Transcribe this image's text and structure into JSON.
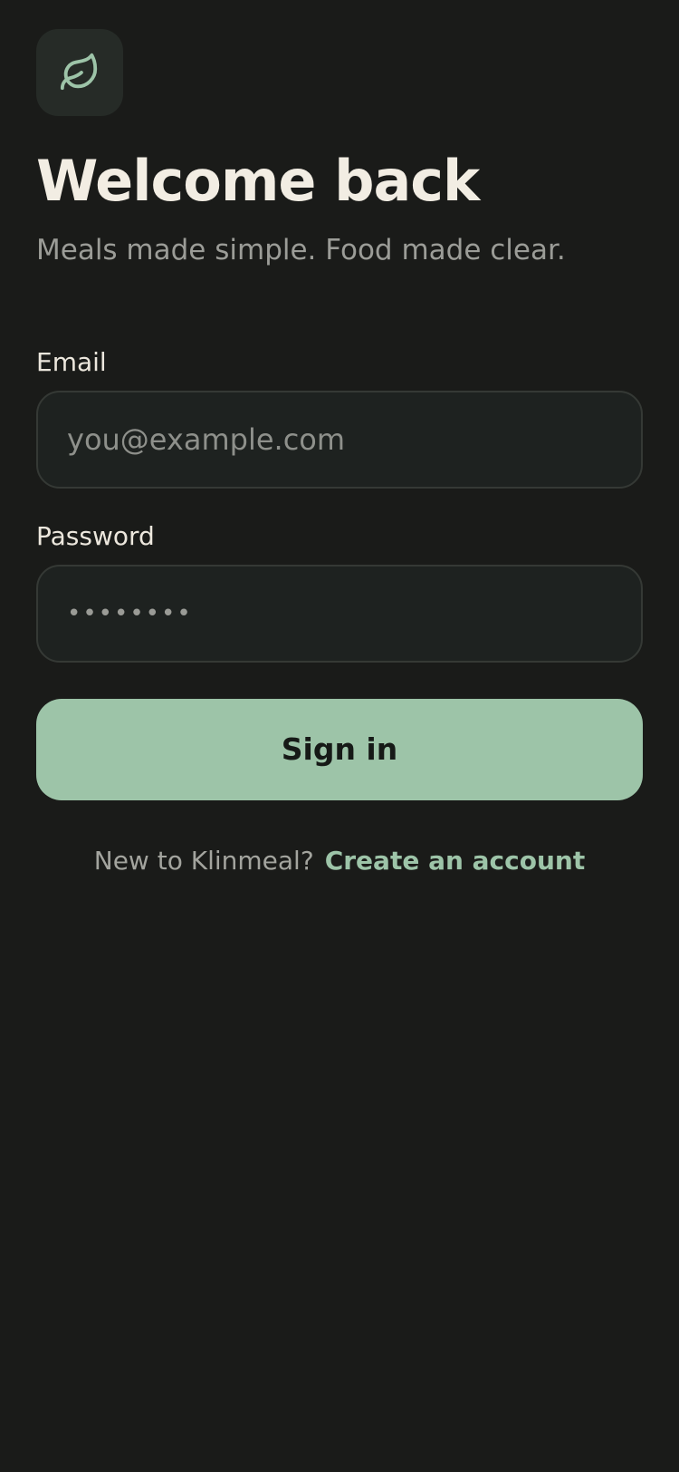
{
  "app": {
    "logo_icon": "leaf-icon",
    "accent_color": "#9dc4a8",
    "background_color": "#1a1b19"
  },
  "header": {
    "title": "Welcome back",
    "subtitle": "Meals made simple. Food made clear."
  },
  "form": {
    "email": {
      "label": "Email",
      "placeholder": "you@example.com",
      "value": ""
    },
    "password": {
      "label": "Password",
      "masked_value": "••••••••"
    },
    "submit_label": "Sign in"
  },
  "footer": {
    "prompt": "New to Klinmeal?",
    "link_label": "Create an account"
  }
}
